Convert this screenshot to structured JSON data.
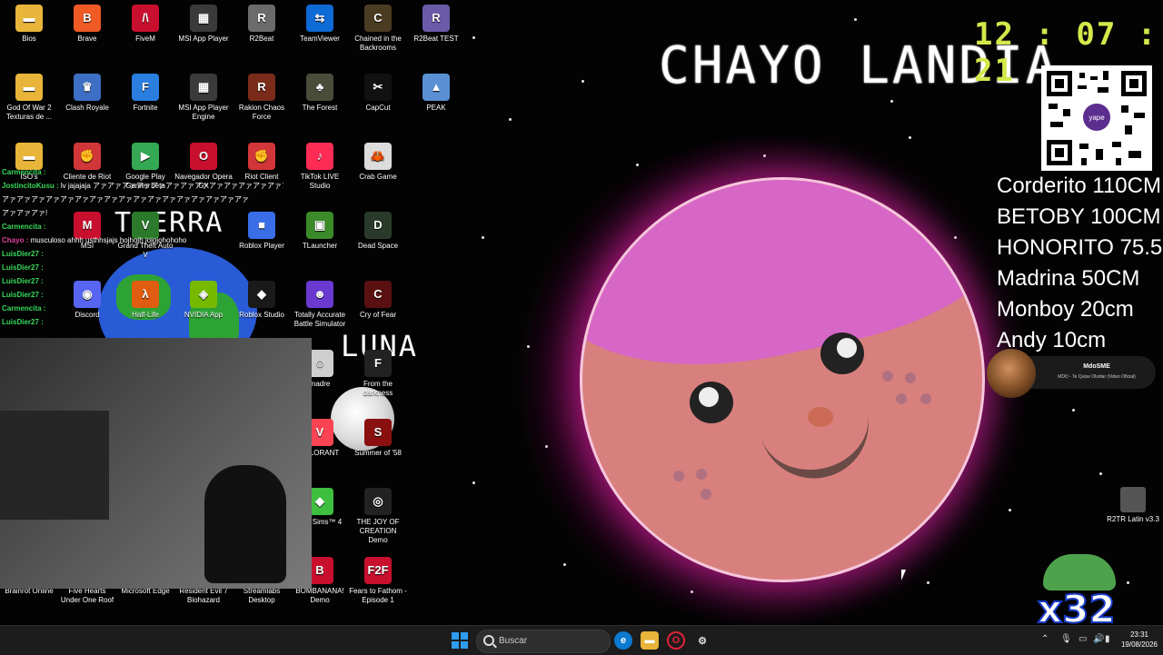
{
  "desktop": {
    "icons": [
      {
        "label": "Bios",
        "color": "#e8b53a",
        "glyph": "▬"
      },
      {
        "label": "Brave",
        "color": "#f05a24",
        "glyph": "B"
      },
      {
        "label": "FiveM",
        "color": "#c8102e",
        "glyph": "/\\"
      },
      {
        "label": "MSI App Player",
        "color": "#3a3a3a",
        "glyph": "▦"
      },
      {
        "label": "R2Beat",
        "color": "#6b6b6b",
        "glyph": "R"
      },
      {
        "label": "TeamViewer",
        "color": "#0e6ad4",
        "glyph": "⇆"
      },
      {
        "label": "Chained in the Backrooms",
        "color": "#4a3b22",
        "glyph": "C"
      },
      {
        "label": "R2Beat TEST",
        "color": "#6b5aa8",
        "glyph": "R"
      },
      {
        "label": "God Of War 2 Texturas de ...",
        "color": "#e8b53a",
        "glyph": "▬"
      },
      {
        "label": "Clash Royale",
        "color": "#3d6fc4",
        "glyph": "♛"
      },
      {
        "label": "Fortnite",
        "color": "#2a7ee0",
        "glyph": "F"
      },
      {
        "label": "MSI App Player Engine",
        "color": "#3a3a3a",
        "glyph": "▦"
      },
      {
        "label": "Rakion Chaos Force",
        "color": "#7a2b1a",
        "glyph": "R"
      },
      {
        "label": "The Forest",
        "color": "#4b4b3a",
        "glyph": "♣"
      },
      {
        "label": "CapCut",
        "color": "#111",
        "glyph": "✂"
      },
      {
        "label": "PEAK",
        "color": "#5a8fd4",
        "glyph": "▲"
      },
      {
        "label": "ISO's",
        "color": "#e8b53a",
        "glyph": "▬"
      },
      {
        "label": "Cliente de Riot",
        "color": "#d13639",
        "glyph": "✊"
      },
      {
        "label": "Google Play Games beta",
        "color": "#34a853",
        "glyph": "▶"
      },
      {
        "label": "Navegador Opera GX",
        "color": "#c8102e",
        "glyph": "O"
      },
      {
        "label": "Riot Client",
        "color": "#d13639",
        "glyph": "✊"
      },
      {
        "label": "TikTok LIVE Studio",
        "color": "#fe2c55",
        "glyph": "♪"
      },
      {
        "label": "Crab Game",
        "color": "#dcdcdc",
        "glyph": "🦀"
      },
      {
        "label": "MSI",
        "color": "#c8102e",
        "glyph": "M"
      },
      {
        "label": "Grand Theft Auto V",
        "color": "#2b7a2b",
        "glyph": "V"
      },
      {
        "label": "Roblox Player",
        "color": "#3a6ee8",
        "glyph": "■"
      },
      {
        "label": "TLauncher",
        "color": "#3b8a2a",
        "glyph": "▣"
      },
      {
        "label": "Dead Space",
        "color": "#2a3a2a",
        "glyph": "D"
      },
      {
        "label": "Discord",
        "color": "#5865f2",
        "glyph": "◉"
      },
      {
        "label": "Half-Life",
        "color": "#e05c10",
        "glyph": "λ"
      },
      {
        "label": "NVIDIA App",
        "color": "#76b900",
        "glyph": "◈"
      },
      {
        "label": "Roblox Studio",
        "color": "#1a1a1a",
        "glyph": "◆"
      },
      {
        "label": "Totally Accurate Battle Simulator",
        "color": "#6a3ad0",
        "glyph": "☻"
      },
      {
        "label": "Cry of Fear",
        "color": "#5a1010",
        "glyph": "C"
      },
      {
        "label": "madre",
        "color": "#cfcfcf",
        "glyph": "☺"
      },
      {
        "label": "From the darkness",
        "color": "#222",
        "glyph": "F"
      },
      {
        "label": "VALORANT",
        "color": "#fa4454",
        "glyph": "V"
      },
      {
        "label": "Summer of '58",
        "color": "#8a1010",
        "glyph": "S"
      },
      {
        "label": "The Sims™ 4",
        "color": "#3fbf3f",
        "glyph": "◆"
      },
      {
        "label": "THE JOY OF CREATION Demo",
        "color": "#222",
        "glyph": "◎"
      },
      {
        "label": "Brainrot Online",
        "color": "#333",
        "glyph": "B"
      },
      {
        "label": "Five Hearts Under One Roof",
        "color": "#333",
        "glyph": "♥"
      },
      {
        "label": "Microsoft Edge",
        "color": "#0c7ad1",
        "glyph": "e"
      },
      {
        "label": "Resident Evil 7 Biohazard",
        "color": "#333",
        "glyph": "R"
      },
      {
        "label": "Streamlabs Desktop",
        "color": "#333",
        "glyph": "S"
      },
      {
        "label": "BOMBANANA! Demo",
        "color": "#c8102e",
        "glyph": "B"
      },
      {
        "label": "Fears to Fathom - Episode 1",
        "color": "#c8102e",
        "glyph": "F2F"
      }
    ]
  },
  "overlay": {
    "title": "CHAYO LANDIA",
    "clock": "12 : 07 : 21",
    "qr_brand": "yape",
    "ranking": [
      "Corderito 110CM",
      "BETOBY 100CM",
      "HONORITO 75.5CM",
      "Madrina 50CM",
      "Monboy 20cm",
      "Andy 10cm"
    ],
    "music": {
      "artist": "MdoSME",
      "track": "MDO - Te Quise Olvidar (Video Oficial)"
    },
    "tierra_label": "TIERRA",
    "luna_label": "LUNA",
    "counter": "x32",
    "r2tr_label": "R2TR Latin v3.3"
  },
  "chat": [
    {
      "user": "Carmencita :",
      "msg": "",
      "pink": false
    },
    {
      "user": "JostincitoKusu :",
      "msg": "lv jajajaja アァアァアァアァアァアァアァアァアァアァアァアァアァアァア",
      "pink": false
    },
    {
      "user": "",
      "msg": "アァアァアァアァアァアァアァアァアァアァアァアァアァアァアァアァアァ",
      "pink": false
    },
    {
      "user": "",
      "msg": "アァアァアァ!",
      "pink": false
    },
    {
      "user": "Carmencita :",
      "msg": "",
      "pink": false
    },
    {
      "user": "Chayo :",
      "msg": "musculoso ahhh usthhsjajs hojhojh jojojohohoho",
      "pink": true
    },
    {
      "user": "LuisDier27 :",
      "msg": "",
      "pink": false
    },
    {
      "user": "LuisDier27 :",
      "msg": "",
      "pink": false
    },
    {
      "user": "LuisDier27 :",
      "msg": "",
      "pink": false
    },
    {
      "user": "LuisDier27 :",
      "msg": "",
      "pink": false
    },
    {
      "user": "Carmencita :",
      "msg": "",
      "pink": false
    },
    {
      "user": "LuisDier27 :",
      "msg": "",
      "pink": false
    }
  ],
  "taskbar": {
    "search_placeholder": "Buscar",
    "time": "23:31",
    "date": "19/08/2026"
  }
}
